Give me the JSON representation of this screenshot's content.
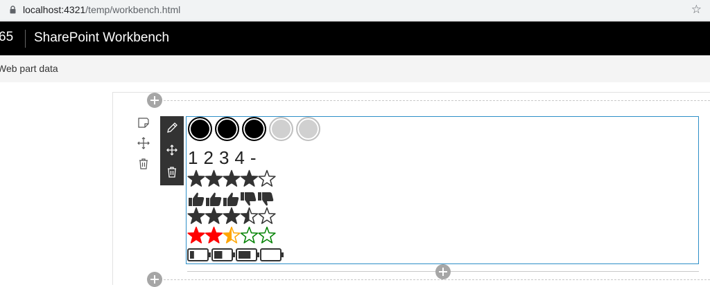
{
  "browser": {
    "url_host": "localhost:4321",
    "url_path": "/temp/workbench.html"
  },
  "suite": {
    "app_number": "65",
    "title": "SharePoint Workbench"
  },
  "command_bar": {
    "web_part_data": "Web part data"
  },
  "webpart": {
    "circle_rating": {
      "value": 3,
      "max": 5
    },
    "number_scale": [
      "1",
      "2",
      "3",
      "4",
      "-"
    ],
    "star_rating_1": {
      "value": 4,
      "max": 5
    },
    "thumbs_rating": {
      "up": 3,
      "down": 2
    },
    "star_rating_2": {
      "value": 3.5,
      "max": 5
    },
    "traffic_stars": {
      "value": 2.5,
      "max": 5
    },
    "battery_rating": {
      "levels": [
        0.25,
        0.5,
        0.75,
        0.0
      ]
    },
    "colors": {
      "red": "#ff0000",
      "orange": "#ffa500",
      "green": "#008000",
      "dark": "#333333",
      "frame": "#2d8fc8"
    }
  }
}
